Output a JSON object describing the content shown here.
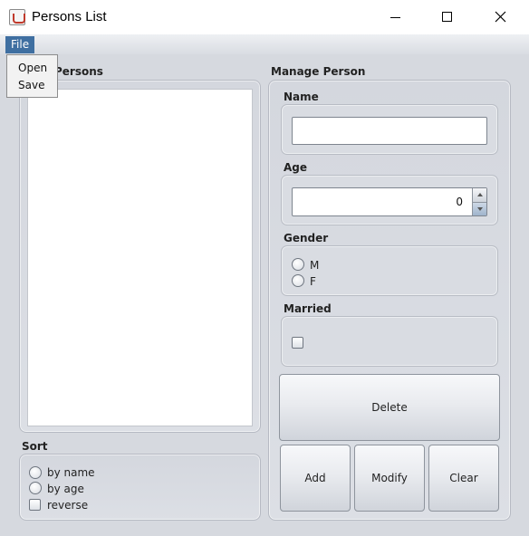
{
  "window": {
    "title": "Persons List"
  },
  "menu": {
    "file_label": "File",
    "items": [
      "Open",
      "Save"
    ]
  },
  "persons_panel": {
    "title": "Persons"
  },
  "manage_panel": {
    "title": "Manage Person",
    "name": {
      "label": "Name",
      "value": ""
    },
    "age": {
      "label": "Age",
      "value": "0"
    },
    "gender": {
      "label": "Gender",
      "options": [
        "M",
        "F"
      ]
    },
    "married": {
      "label": "Married"
    }
  },
  "sort": {
    "title": "Sort",
    "options": [
      "by name",
      "by age"
    ],
    "reverse_label": "reverse"
  },
  "buttons": {
    "delete": "Delete",
    "add": "Add",
    "modify": "Modify",
    "clear": "Clear"
  }
}
